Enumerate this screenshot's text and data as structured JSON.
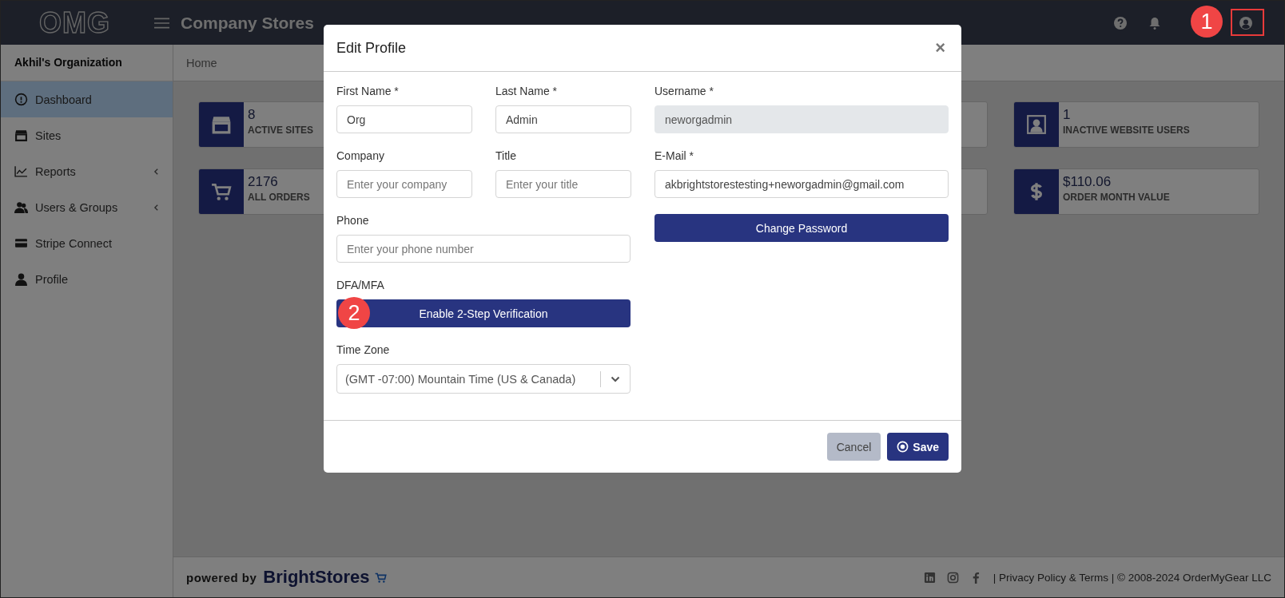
{
  "header": {
    "logo": "OMG",
    "title": "Company Stores",
    "annotation": "1",
    "user_highlighted": true
  },
  "sidebar": {
    "organization": "Akhil's Organization",
    "items": [
      {
        "label": "Dashboard",
        "kind": "dashboard",
        "selected": true,
        "submenu": false
      },
      {
        "label": "Sites",
        "kind": "store",
        "selected": false,
        "submenu": false
      },
      {
        "label": "Reports",
        "kind": "chart",
        "selected": false,
        "submenu": true
      },
      {
        "label": "Users & Groups",
        "kind": "users",
        "selected": false,
        "submenu": true
      },
      {
        "label": "Stripe Connect",
        "kind": "card",
        "selected": false,
        "submenu": false
      },
      {
        "label": "Profile",
        "kind": "person",
        "selected": false,
        "submenu": false
      }
    ]
  },
  "breadcrumb": "Home",
  "stats_rows": [
    {
      "left": {
        "value": "8",
        "label": "ACTIVE SITES",
        "kind": "store"
      },
      "right": {
        "value": "1",
        "label": "INACTIVE WEBSITE USERS",
        "kind": "portrait"
      }
    },
    {
      "left": {
        "value": "2176",
        "label": "ALL ORDERS",
        "kind": "cart"
      },
      "right": {
        "value": "$110.06",
        "label": "ORDER MONTH VALUE",
        "kind": "dollar"
      }
    }
  ],
  "modal": {
    "title": "Edit Profile",
    "close": "×",
    "first_name": {
      "label": "First Name *",
      "value": "Org"
    },
    "last_name": {
      "label": "Last Name *",
      "value": "Admin"
    },
    "company": {
      "label": "Company",
      "placeholder": "Enter your company"
    },
    "title_field": {
      "label": "Title",
      "placeholder": "Enter your title"
    },
    "phone": {
      "label": "Phone",
      "placeholder": "Enter your phone number"
    },
    "mfa": {
      "label": "DFA/MFA",
      "button": "Enable 2-Step Verification",
      "annotation": "2"
    },
    "time_zone": {
      "label": "Time Zone",
      "value": "(GMT -07:00) Mountain Time (US & Canada)"
    },
    "username": {
      "label": "Username *",
      "value": "neworgadmin",
      "disabled": true
    },
    "email": {
      "label": "E-Mail *",
      "value": "akbrightstorestesting+neworgadmin@gmail.com"
    },
    "change_password": "Change Password",
    "buttons": {
      "cancel": "Cancel",
      "save": "Save"
    }
  },
  "footer": {
    "powered_by": "powered by",
    "brand": "BrightStores",
    "links": "| Privacy Policy & Terms | © 2008-2024 OrderMyGear LLC"
  }
}
